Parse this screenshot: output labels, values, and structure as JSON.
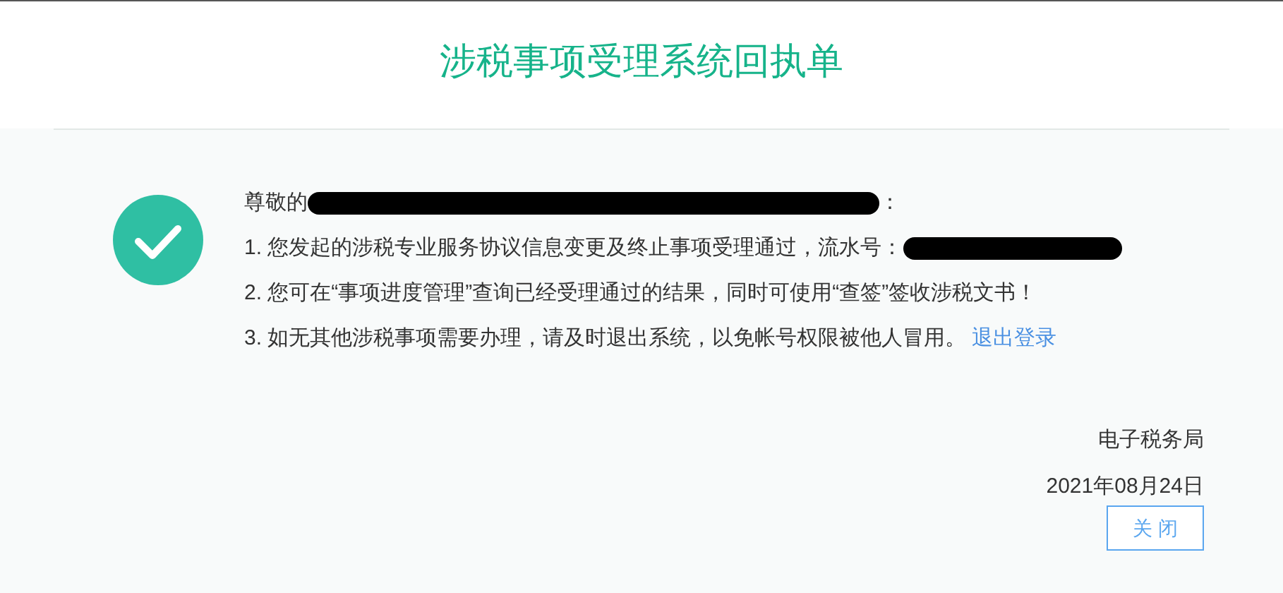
{
  "title": "涉税事项受理系统回执单",
  "lines": [
    {
      "segments": [
        {
          "kind": "text",
          "text": "尊敬的"
        },
        {
          "kind": "redacted"
        },
        {
          "kind": "text",
          "text": "："
        }
      ]
    },
    {
      "segments": [
        {
          "kind": "text",
          "text": "1. 您发起的涉税专业服务协议信息变更及终止事项受理通过，流水号："
        },
        {
          "kind": "redacted"
        }
      ]
    },
    {
      "segments": [
        {
          "kind": "text",
          "text": "2. 您可在“事项进度管理”查询已经受理通过的结果，同时可使用“查签”签收涉税文书！"
        }
      ]
    },
    {
      "segments": [
        {
          "kind": "text",
          "text": "3. 如无其他涉税事项需要办理，请及时退出系统，以免帐号权限被他人冒用。"
        },
        {
          "kind": "link",
          "text": "退出登录"
        }
      ]
    }
  ],
  "signature": "电子税务局",
  "date": "2021年08月24日",
  "close_button": "关 闭"
}
